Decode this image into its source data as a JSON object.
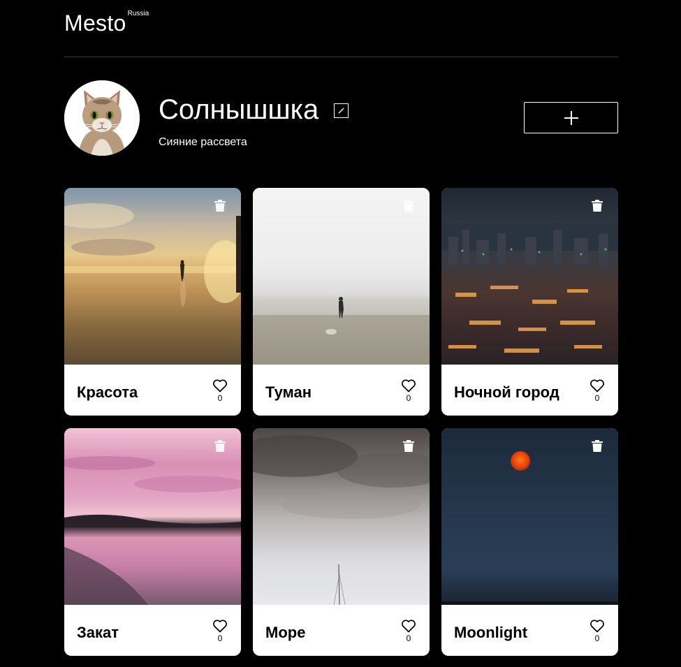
{
  "header": {
    "logo": "Mesto",
    "logo_sup": "Russia"
  },
  "profile": {
    "name": "Солнышшка",
    "about": "Сияние рассвета",
    "avatar_icon": "cat-avatar"
  },
  "cards": [
    {
      "title": "Красота",
      "likes": "0",
      "image": "beach-surfer-sunset"
    },
    {
      "title": "Туман",
      "likes": "0",
      "image": "foggy-beach-surfer"
    },
    {
      "title": "Ночной город",
      "likes": "0",
      "image": "night-city-aerial"
    },
    {
      "title": "Закат",
      "likes": "0",
      "image": "pink-sunset-shore"
    },
    {
      "title": "Море",
      "likes": "0",
      "image": "cloudy-sea-mast"
    },
    {
      "title": "Moonlight",
      "likes": "0",
      "image": "red-moon-dark-sky"
    }
  ],
  "colors": {
    "background": "#000000",
    "card": "#ffffff",
    "text_light": "#ffffff",
    "text_dark": "#000000"
  }
}
